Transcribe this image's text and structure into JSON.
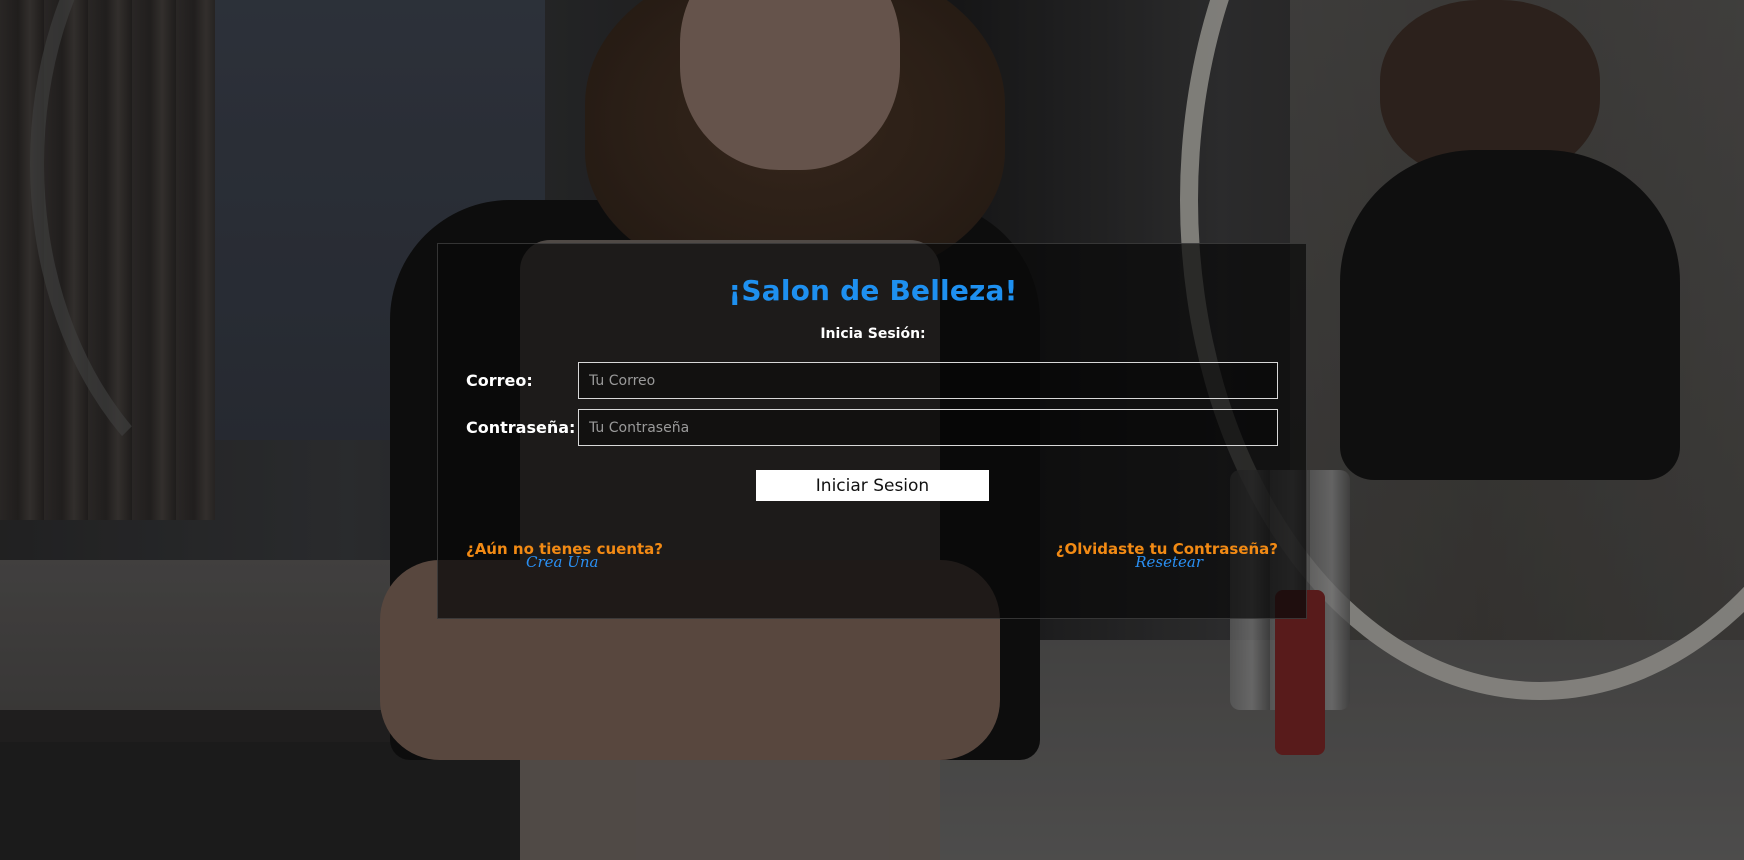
{
  "app": {
    "title": "¡Salon de Belleza!",
    "subtitle": "Inicia Sesión:"
  },
  "form": {
    "email": {
      "label": "Correo:",
      "placeholder": "Tu Correo",
      "value": ""
    },
    "password": {
      "label": "Contraseña:",
      "placeholder": "Tu Contraseña",
      "value": ""
    },
    "submit_label": "Iniciar Sesion"
  },
  "links": {
    "create_account": {
      "question": "¿Aún no tienes cuenta?",
      "action": "Crea Una"
    },
    "forgot_password": {
      "question": "¿Olvidaste tu Contraseña?",
      "action": "Resetear"
    }
  },
  "colors": {
    "title": "#1e90f0",
    "link_question": "#f28a14",
    "link_action": "#2a8ff2",
    "panel_bg": "rgba(10,10,10,0.72)",
    "button_bg": "#ffffff"
  }
}
